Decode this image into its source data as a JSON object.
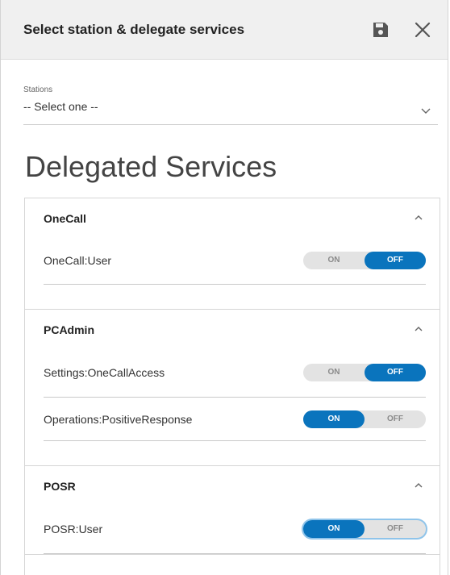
{
  "header": {
    "title": "Select station & delegate services",
    "save_icon": "save-icon",
    "close_icon": "close-icon"
  },
  "stations": {
    "label": "Stations",
    "value": "-- Select one --"
  },
  "section_title": "Delegated Services",
  "groups": [
    {
      "name": "OneCall",
      "expanded": true,
      "services": [
        {
          "name": "OneCall:User",
          "on_label": "ON",
          "off_label": "OFF",
          "state": "off"
        }
      ]
    },
    {
      "name": "PCAdmin",
      "expanded": true,
      "services": [
        {
          "name": "Settings:OneCallAccess",
          "on_label": "ON",
          "off_label": "OFF",
          "state": "off"
        },
        {
          "name": "Operations:PositiveResponse",
          "on_label": "ON",
          "off_label": "OFF",
          "state": "on"
        }
      ]
    },
    {
      "name": "POSR",
      "expanded": true,
      "services": [
        {
          "name": "POSR:User",
          "on_label": "ON",
          "off_label": "OFF",
          "state": "on",
          "focused": true
        }
      ]
    }
  ],
  "colors": {
    "accent": "#0a74bd",
    "toggle_track": "#e3e3e3",
    "header_bg": "#f0f0f0"
  }
}
